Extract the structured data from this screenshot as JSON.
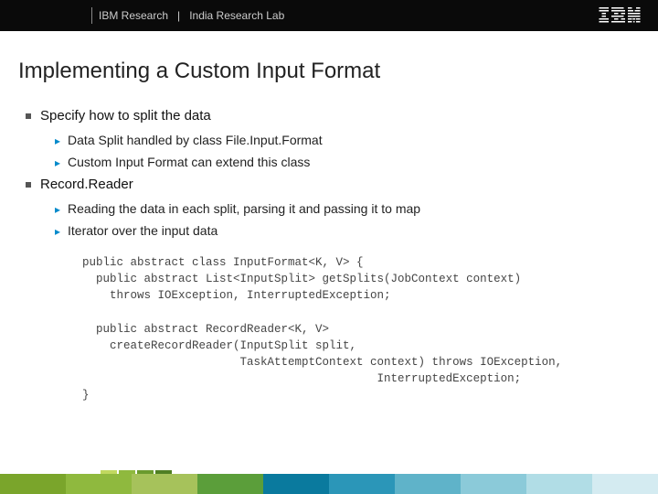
{
  "header": {
    "org": "IBM Research",
    "divider": "|",
    "lab": "India Research Lab",
    "logo_name": "IBM"
  },
  "title": "Implementing a Custom Input Format",
  "sections": [
    {
      "label": "Specify how to split the data",
      "subs": [
        "Data Split handled by class File.Input.Format",
        "Custom Input Format can extend this class"
      ]
    },
    {
      "label": "Record.Reader",
      "subs": [
        "Reading the data in each split, parsing it and passing it to map",
        "Iterator over the input data"
      ]
    }
  ],
  "code": "public abstract class InputFormat<K, V> {\n  public abstract List<InputSplit> getSplits(JobContext context)\n    throws IOException, InterruptedException;\n\n  public abstract RecordReader<K, V>\n    createRecordReader(InputSplit split,\n                       TaskAttemptContext context) throws IOException,\n                                           InterruptedException;\n}",
  "footer_colors": [
    "#7aa52b",
    "#8fb93e",
    "#a6c25b",
    "#5b9e3a",
    "#0a7a9e",
    "#2b96b8",
    "#5fb3c9",
    "#8bcad9",
    "#b1dde6",
    "#d4ebf1"
  ],
  "logo_blocks": [
    "#c0d85f",
    "#8fb93e",
    "#6a9a2e",
    "#4f7f24"
  ]
}
